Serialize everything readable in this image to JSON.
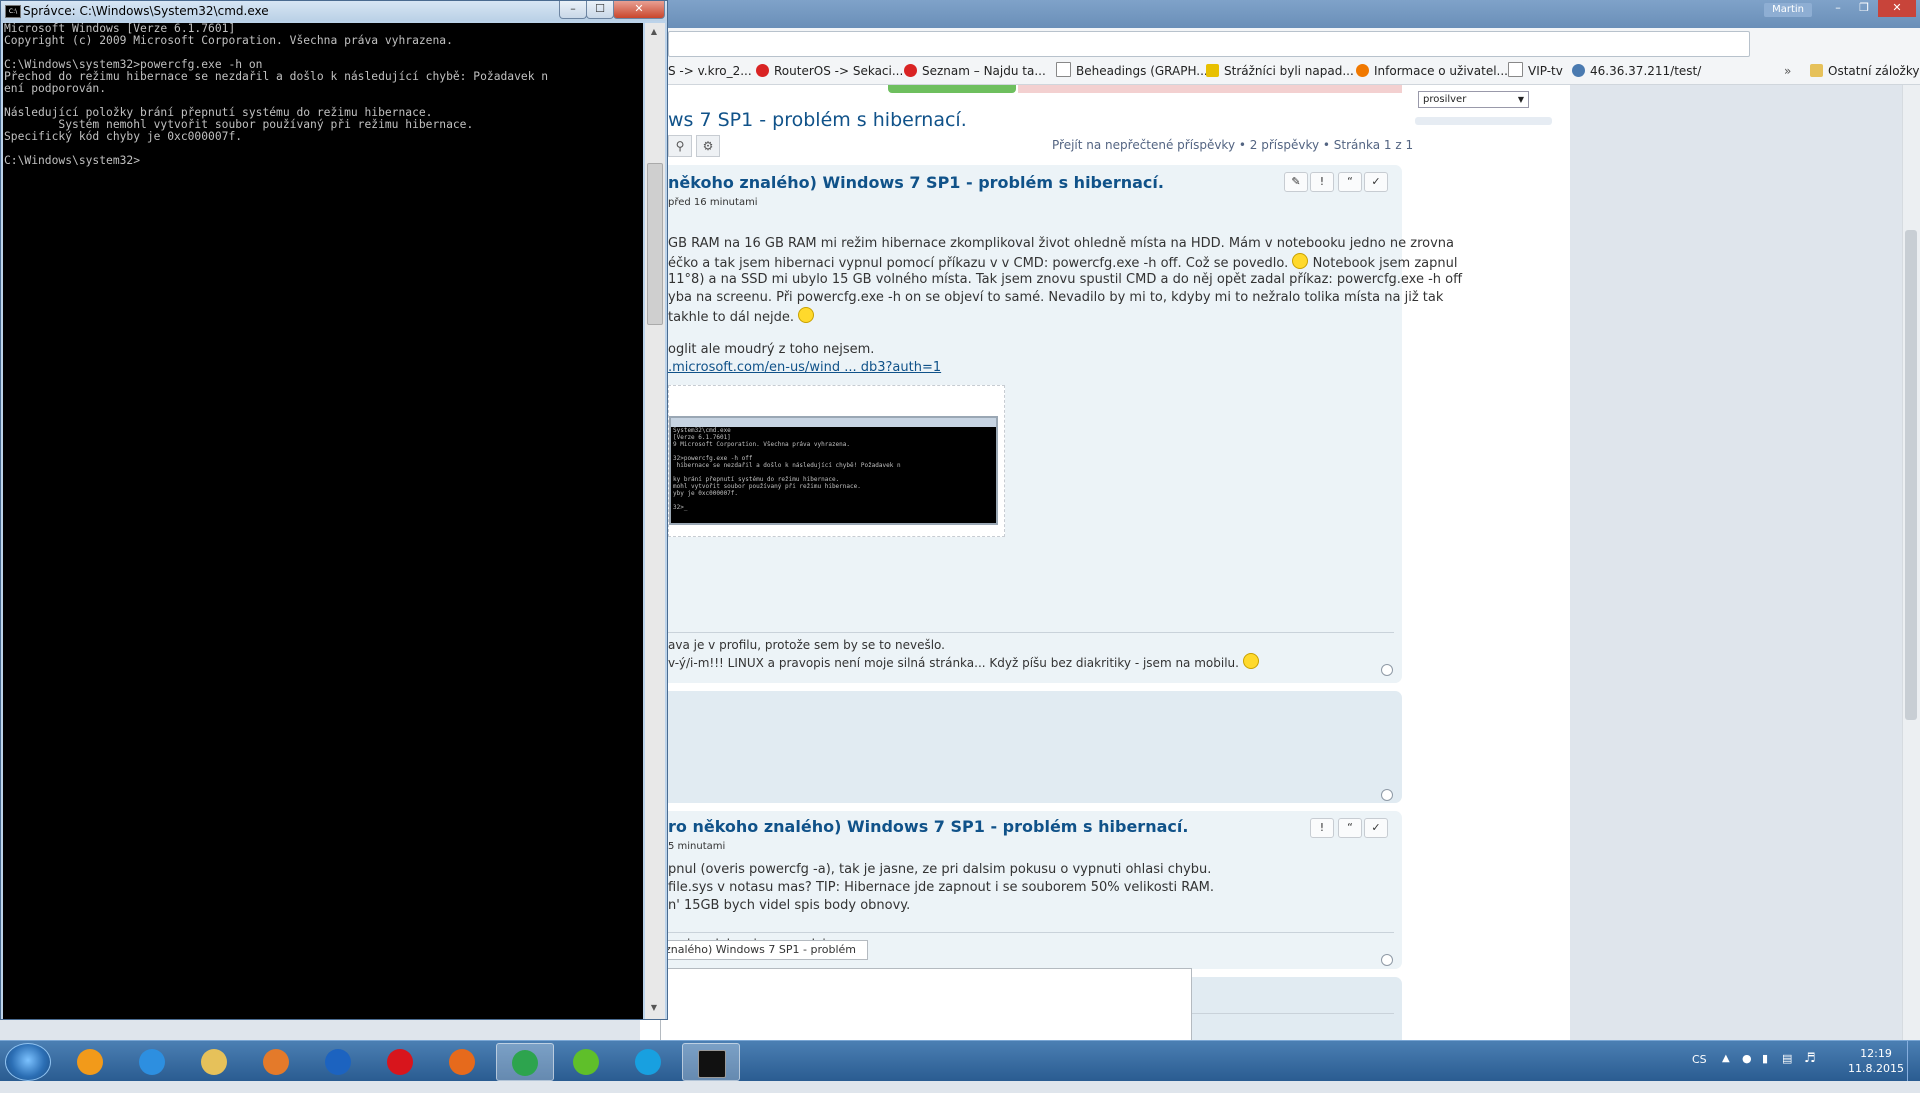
{
  "cmd": {
    "title": "Správce: C:\\Windows\\System32\\cmd.exe",
    "console_text": "Microsoft Windows [Verze 6.1.7601]\nCopyright (c) 2009 Microsoft Corporation. Všechna práva vyhrazena.\n\nC:\\Windows\\system32>powercfg.exe -h on\nPřechod do režimu hibernace se nezdařil a došlo k následující chybě: Požadavek n\není podporován.\n\nNásledující položky brání přepnutí systému do režimu hibernace.\n        Systém nemohl vytvořit soubor používaný při režimu hibernace.\nSpecifický kód chyby je 0xc000007f.\n\nC:\\Windows\\system32>"
  },
  "chrome": {
    "user_name": "Martin",
    "bookmarks": [
      {
        "label": "S -> v.kro_2...",
        "icon": "page-icon",
        "color": "#888888"
      },
      {
        "label": "RouterOS -> Sekaci...",
        "icon": "seznam-icon",
        "color": "#d92323"
      },
      {
        "label": "Seznam – Najdu ta...",
        "icon": "seznam-icon",
        "color": "#d92323"
      },
      {
        "label": "Beheadings (GRAPH...",
        "icon": "page-icon",
        "color": "#666666"
      },
      {
        "label": "Strážníci byli napad...",
        "icon": "kp-icon",
        "color": "#e8c000"
      },
      {
        "label": "Informace o uživatel...",
        "icon": "forum-icon",
        "color": "#f07800"
      },
      {
        "label": "VIP-tv",
        "icon": "page-icon",
        "color": "#666666"
      },
      {
        "label": "46.36.37.211/test/",
        "icon": "globe-icon",
        "color": "#4a7ab0"
      }
    ],
    "other_bookmarks": "Ostatní záložky"
  },
  "forum": {
    "style_select": "prosilver",
    "topic_title": "ws 7 SP1 - problém s hibernací.",
    "topic_stats": "Přejít na nepřečtené příspěvky • 2 příspěvky • Stránka 1 z 1",
    "post1": {
      "title": "někoho znalého) Windows 7 SP1 - problém s hibernací.",
      "meta": "před 16 minutami",
      "lines": [
        "GB RAM na 16 GB RAM mi režim hibernace zkomplikoval život ohledně místa na HDD. Mám v notebooku jedno ne zrovna",
        "éčko a tak jsem hibernaci vypnul pomocí příkazu v v CMD: powercfg.exe -h off. Což se povedlo.",
        "Notebook jsem zapnul",
        "11°8) a na SSD mi ubylo 15 GB volného místa. Tak jsem znovu spustil CMD a do něj opět zadal příkaz: powercfg.exe -h off",
        "yba na screenu. Při powercfg.exe -h on se objeví to samé. Nevadilo by mi to, kdyby mi to nežralo tolika místa na již tak",
        "takhle to dál nejde.",
        "oglit ale moudrý z toho nejsem.",
        ".microsoft.com/en-us/wind ... db3?auth=1"
      ],
      "screenshot_text": "System32\\cmd.exe\n[Verze 6.1.7601]\n9 Microsoft Corporation. Všechna práva vyhrazena.\n\n32>powercfg.exe -h off\n hibernace se nezdařil a došlo k následující chybě! Požadavek n\n\nky brání přepnutí systému do režimu hibernace.\nmohl vytvořit soubor používaný při režimu hibernace.\nyby je 0xc000007f.\n\n32>_",
      "sig1": "ava je v profilu, protože sem by se to nevešlo.",
      "sig2": "v-ý/i-m!!! LINUX a pravopis není moje silná stránka... Když píšu bez diakritiky - jsem na mobilu."
    },
    "post2": {
      "title": "ro někoho znalého) Windows 7 SP1 - problém s hibernací.",
      "meta": "5 minutami",
      "lines": [
        "pnul (overis powercfg -a), tak je jasne, ze pri dalsim pokusu o vypnuti ohlasi chybu.",
        "file.sys v notasu mas? TIP: Hibernace jde zapnout i se souborem 50% velikosti RAM.",
        "n' 15GB bych videl spis body obnovy."
      ],
      "sig": "maj, az kdyz si me zavolaj.."
    },
    "reply_subject": "znalého) Windows 7 SP1 - problém"
  },
  "taskbar": {
    "apps": [
      {
        "name": "aimp-icon",
        "color": "#f29a1a"
      },
      {
        "name": "internet-explorer-icon",
        "color": "#2d8fe0"
      },
      {
        "name": "file-explorer-icon",
        "color": "#e6c15a"
      },
      {
        "name": "media-player-icon",
        "color": "#e47a2a"
      },
      {
        "name": "typing-icon",
        "color": "#1c63c0"
      },
      {
        "name": "opera-icon",
        "color": "#d8151c"
      },
      {
        "name": "firefox-icon",
        "color": "#e66a1c"
      },
      {
        "name": "chrome-icon",
        "color": "#2da44e"
      },
      {
        "name": "icq-icon",
        "color": "#5fbf2a"
      },
      {
        "name": "skype-icon",
        "color": "#18a0e0"
      },
      {
        "name": "cmd-icon",
        "color": "#111111"
      }
    ],
    "language": "CS",
    "time": "12:19",
    "date": "11.8.2015"
  }
}
